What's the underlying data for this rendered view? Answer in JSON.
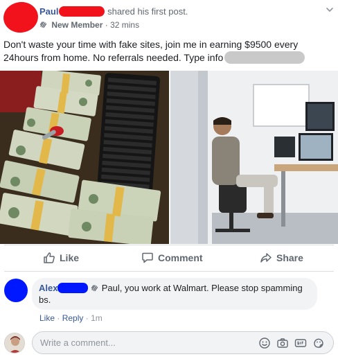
{
  "post": {
    "author_first": "Paul",
    "action": "shared his first post.",
    "badge": "New Member",
    "separator": "·",
    "time": "32 mins",
    "text_main": "Don't waste your time with fake sites, join me in earning $9500 every 24hours from home. No referrals needed. Type info"
  },
  "images": {
    "left": "money-stacks-keyboard-photo",
    "right": "man-at-office-desk-photo"
  },
  "actions": {
    "like": "Like",
    "comment": "Comment",
    "share": "Share"
  },
  "comment": {
    "author_first": "Alex",
    "text_line1": "Paul, you work at Walmart. Please stop spamming",
    "text_line2": "bs.",
    "like": "Like",
    "reply": "Reply",
    "dot": "·",
    "time": "1m"
  },
  "composer": {
    "placeholder": "Write a comment..."
  },
  "colors": {
    "link": "#385898",
    "redact_red": "#f1121b",
    "redact_blue": "#0018ff",
    "redact_grey": "#c9c9c9"
  }
}
